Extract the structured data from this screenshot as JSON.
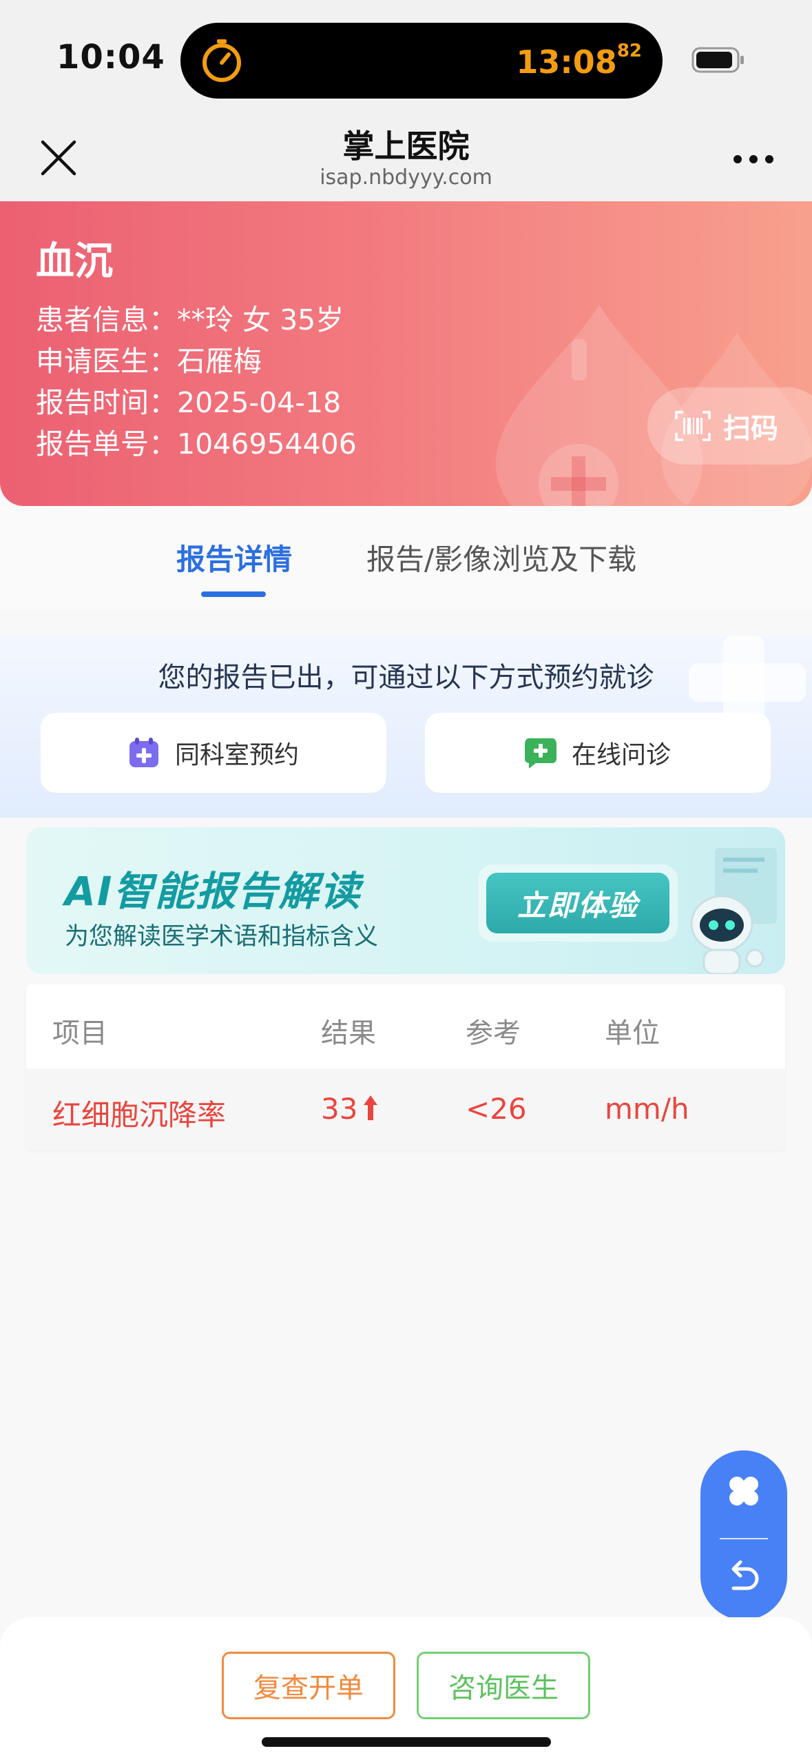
{
  "status_bar": {
    "time": "10:04",
    "timer_main": "13:08",
    "timer_fraction": "82"
  },
  "nav": {
    "title": "掌上医院",
    "url": "isap.nbdyyy.com"
  },
  "report": {
    "title": "血沉",
    "patient_label": "患者信息：",
    "patient_value": "**玲 女 35岁",
    "doctor_label": "申请医生：",
    "doctor_value": "石雁梅",
    "time_label": "报告时间：",
    "time_value": "2025-04-18",
    "number_label": "报告单号：",
    "number_value": "1046954406",
    "scan_label": "扫码"
  },
  "tabs": [
    {
      "label": "报告详情",
      "active": true
    },
    {
      "label": "报告/影像浏览及下载",
      "active": false
    }
  ],
  "notice": {
    "text": "您的报告已出，可通过以下方式预约就诊",
    "btn_same_dept": "同科室预约",
    "btn_online": "在线问诊"
  },
  "ai_banner": {
    "title": "AI智能报告解读",
    "subtitle": "为您解读医学术语和指标含义",
    "button": "立即体验"
  },
  "table": {
    "headers": [
      "项目",
      "结果",
      "参考",
      "单位"
    ],
    "rows": [
      {
        "item": "红细胞沉降率",
        "result": "33",
        "trend": "up",
        "reference": "<26",
        "unit": "mm/h"
      }
    ]
  },
  "bottom": {
    "btn_recheck": "复查开单",
    "btn_consult": "咨询医生"
  },
  "colors": {
    "primary_blue": "#2c6fe0",
    "abnormal_red": "#e8463f",
    "header_gradient_start": "#ec6072",
    "header_gradient_end": "#f8a08e",
    "orange": "#f08a3e",
    "green": "#5ec15f"
  }
}
